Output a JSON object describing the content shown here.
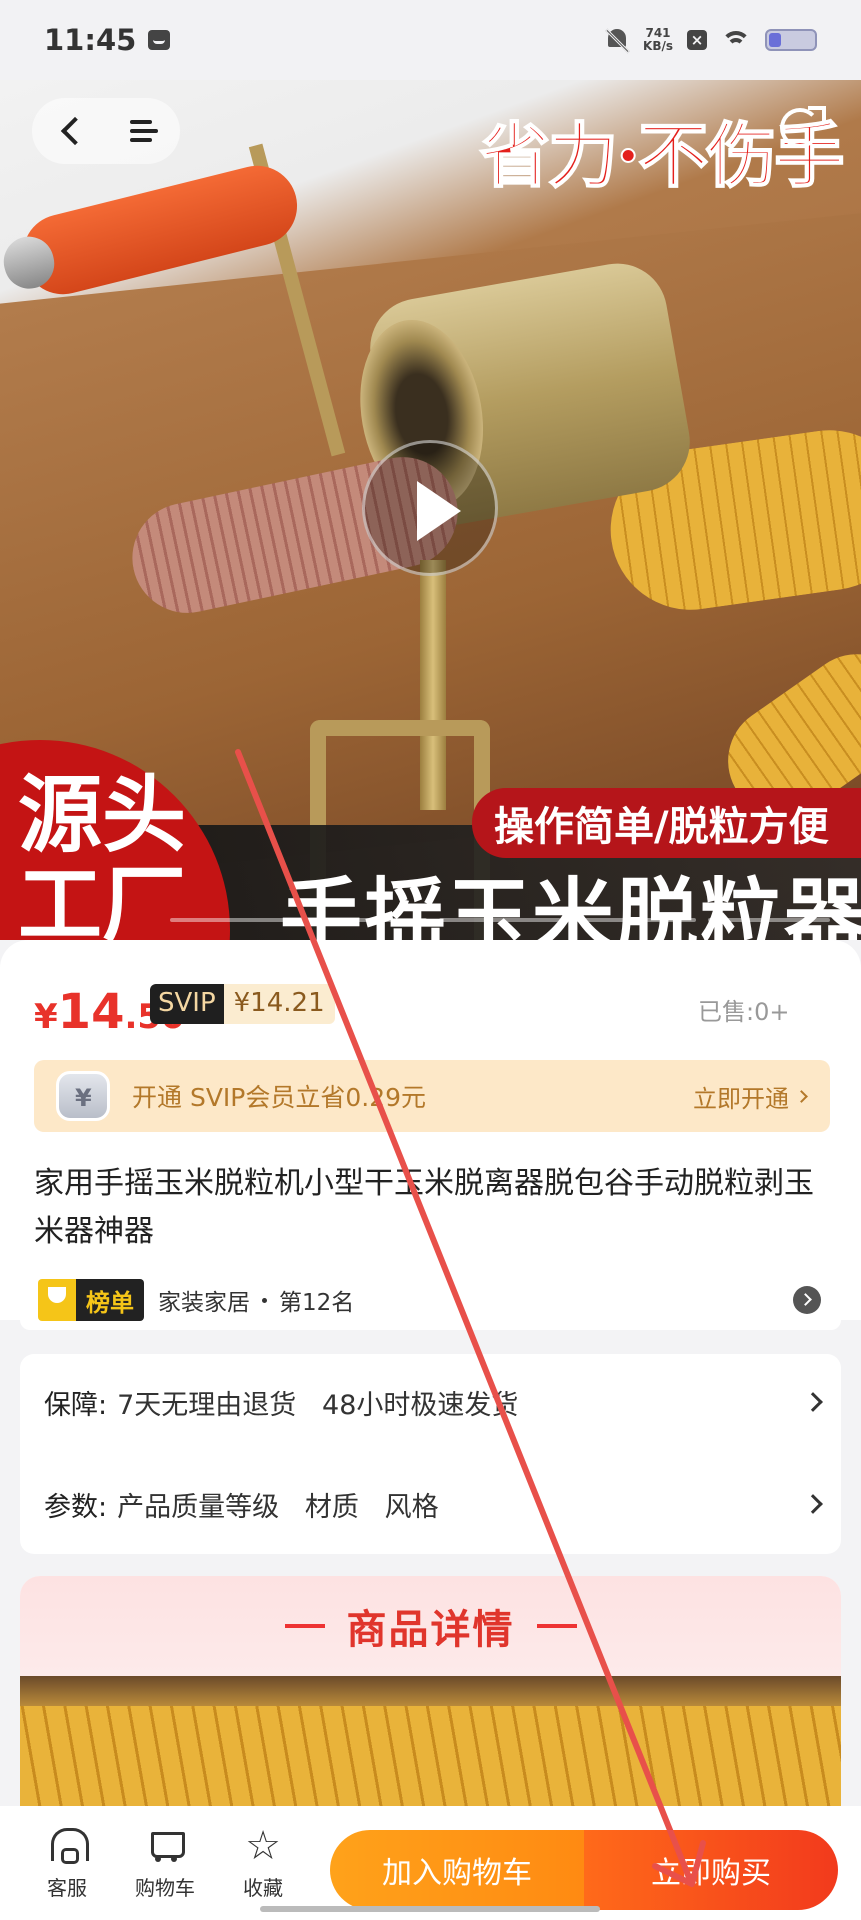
{
  "status_bar": {
    "time": "11:45",
    "speed_value": "741",
    "speed_unit": "KB/s"
  },
  "hero": {
    "top_slogan": "省力·不伤手",
    "badge": "源头工厂",
    "feature_banner": "操作简单/脱粒方便",
    "main_title": "手摇玉米脱粒器"
  },
  "price": {
    "currency": "¥",
    "integer": "14",
    "decimal": ".50",
    "svip_label": "SVIP",
    "svip_price": "¥14.21",
    "sold": "已售:0+"
  },
  "svip_banner": {
    "text": "开通 SVIP会员立省0.29元",
    "link": "立即开通"
  },
  "product": {
    "title": "家用手摇玉米脱粒机小型干玉米脱离器脱包谷手动脱粒剥玉米器神器"
  },
  "rank": {
    "badge": "榜单",
    "category": "家装家居",
    "position": "第12名"
  },
  "info": {
    "guarantee_label": "保障:",
    "guarantee_value": "7天无理由退货   48小时极速发货",
    "params_label": "参数:",
    "params_value": "产品质量等级   材质   风格"
  },
  "detail": {
    "title": "商品详情"
  },
  "bottom_bar": {
    "service": "客服",
    "cart": "购物车",
    "favorite": "收藏",
    "add_to_cart": "加入购物车",
    "buy_now": "立即购买"
  },
  "colors": {
    "price_red": "#e8322a",
    "cart_orange": "#ff9a16",
    "buy_red": "#f23a1c",
    "annotation_arrow": "#e8504a"
  }
}
